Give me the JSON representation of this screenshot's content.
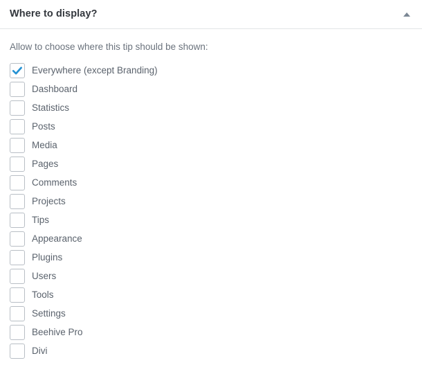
{
  "panel": {
    "title": "Where to display?",
    "collapse_icon": "chevron-up-icon",
    "description": "Allow to choose where this tip should be shown:"
  },
  "colors": {
    "title": "#33373d",
    "description": "#6a727c",
    "label": "#5a626c",
    "checkbox_border": "#b8bec5",
    "check_mark": "#2592d3",
    "divider": "#e2e4e7",
    "background": "#ffffff",
    "collapse_arrow": "#7b8794"
  },
  "options": [
    {
      "label": "Everywhere (except Branding)",
      "checked": true
    },
    {
      "label": "Dashboard",
      "checked": false
    },
    {
      "label": "Statistics",
      "checked": false
    },
    {
      "label": "Posts",
      "checked": false
    },
    {
      "label": "Media",
      "checked": false
    },
    {
      "label": "Pages",
      "checked": false
    },
    {
      "label": "Comments",
      "checked": false
    },
    {
      "label": "Projects",
      "checked": false
    },
    {
      "label": "Tips",
      "checked": false
    },
    {
      "label": "Appearance",
      "checked": false
    },
    {
      "label": "Plugins",
      "checked": false
    },
    {
      "label": "Users",
      "checked": false
    },
    {
      "label": "Tools",
      "checked": false
    },
    {
      "label": "Settings",
      "checked": false
    },
    {
      "label": "Beehive Pro",
      "checked": false
    },
    {
      "label": "Divi",
      "checked": false
    }
  ]
}
